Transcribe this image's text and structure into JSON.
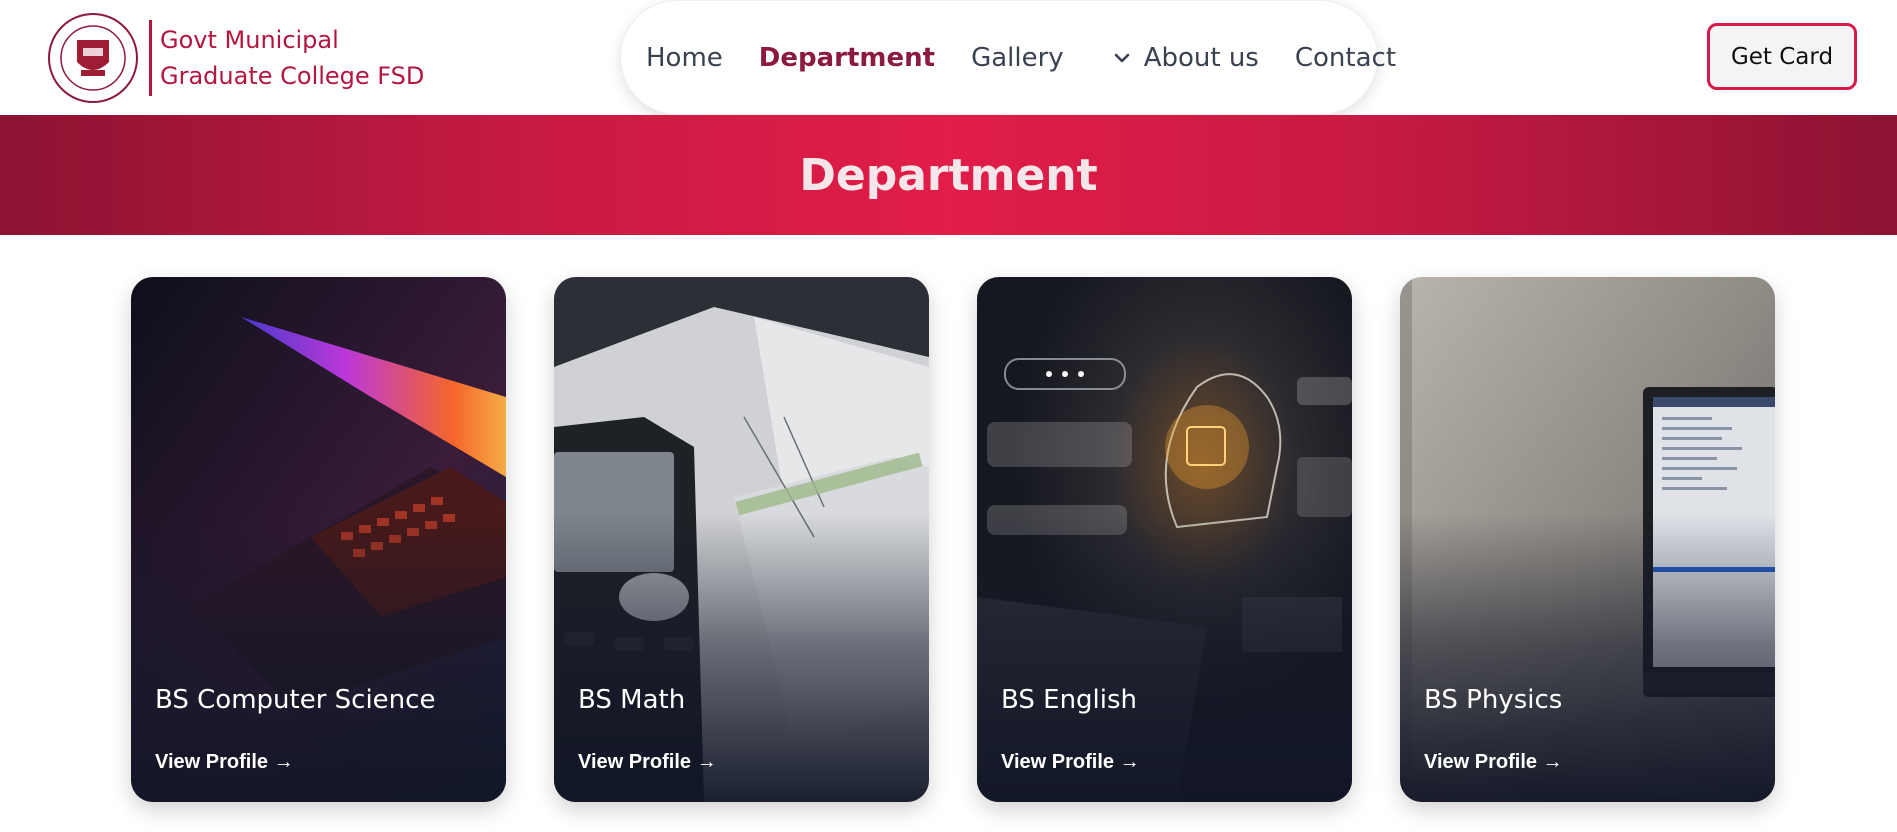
{
  "header": {
    "college_name_line1": "Govt Municipal",
    "college_name_line2": "Graduate College FSD",
    "brand_color": "#b3173f"
  },
  "nav": {
    "items": [
      {
        "label": "Home",
        "active": false
      },
      {
        "label": "Department",
        "active": true
      },
      {
        "label": "Gallery",
        "active": false
      },
      {
        "label": "About us",
        "active": false,
        "icon": "chevron-down-icon"
      },
      {
        "label": "Contact",
        "active": false
      }
    ],
    "active_color": "#8c1a3e"
  },
  "cta": {
    "label": "Get Card"
  },
  "banner": {
    "title": "Department"
  },
  "cards": [
    {
      "title": "BS Computer Science",
      "link": "View Profile →"
    },
    {
      "title": "BS Math",
      "link": "View Profile →"
    },
    {
      "title": "BS English",
      "link": "View Profile →"
    },
    {
      "title": "BS Physics",
      "link": "View Profile →"
    }
  ]
}
